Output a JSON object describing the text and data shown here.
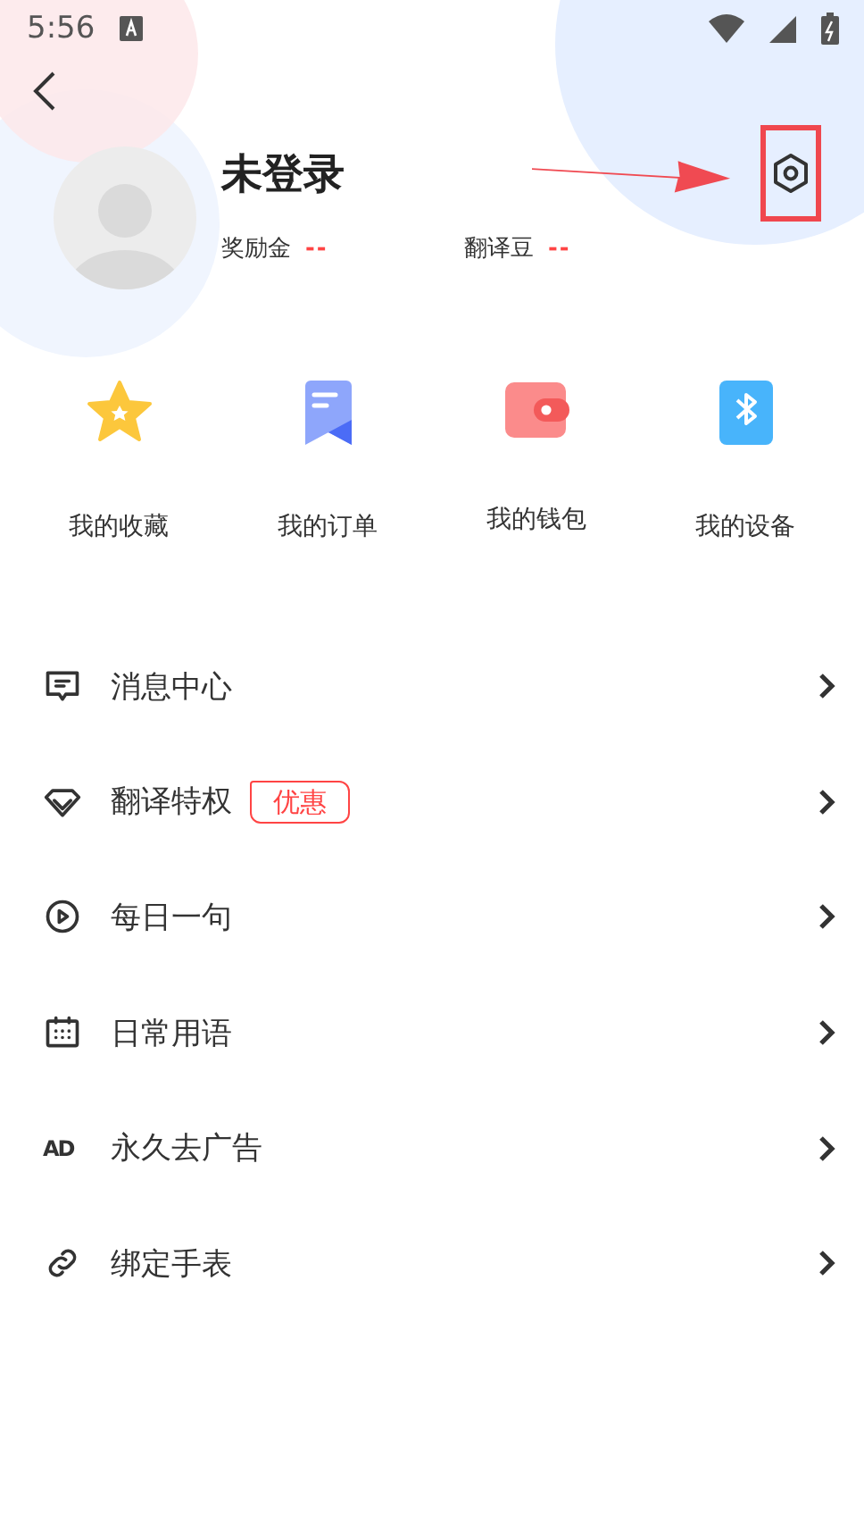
{
  "status_bar": {
    "time": "5:56"
  },
  "profile": {
    "name": "未登录",
    "stats": [
      {
        "label": "奖励金",
        "value": "--"
      },
      {
        "label": "翻译豆",
        "value": "--"
      }
    ]
  },
  "shortcuts": [
    {
      "kind": "star",
      "label": "我的收藏"
    },
    {
      "kind": "order",
      "label": "我的订单"
    },
    {
      "kind": "wallet",
      "label": "我的钱包"
    },
    {
      "kind": "device",
      "label": "我的设备"
    }
  ],
  "menu": [
    {
      "kind": "message",
      "label": "消息中心"
    },
    {
      "kind": "vip",
      "label": "翻译特权",
      "badge": "优惠"
    },
    {
      "kind": "daily",
      "label": "每日一句"
    },
    {
      "kind": "phrases",
      "label": "日常用语"
    },
    {
      "kind": "ad",
      "label": "永久去广告",
      "icon_text": "AD"
    },
    {
      "kind": "watch",
      "label": "绑定手表"
    }
  ]
}
